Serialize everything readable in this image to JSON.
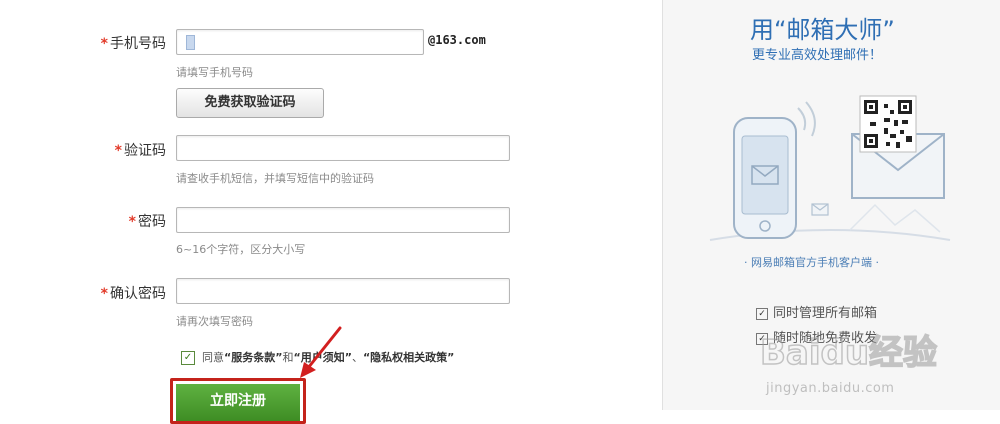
{
  "form": {
    "phone": {
      "label": "手机号码",
      "required_mark": "*",
      "value": "",
      "suffix": "@163.com",
      "hint": "请填写手机号码"
    },
    "get_code_button": "免费获取验证码",
    "code": {
      "label": "验证码",
      "required_mark": "*",
      "value": "",
      "hint": "请查收手机短信，并填写短信中的验证码"
    },
    "password": {
      "label": "密码",
      "required_mark": "*",
      "value": "",
      "hint": "6~16个字符，区分大小写"
    },
    "confirm_password": {
      "label": "确认密码",
      "required_mark": "*",
      "value": "",
      "hint": "请再次填写密码"
    },
    "agree": {
      "checked": true,
      "prefix": "同意",
      "terms": "“服务条款”",
      "and": "和",
      "notice": "“用户须知”",
      "sep": "、",
      "privacy": "“隐私权相关政策”"
    },
    "submit_label": "立即注册"
  },
  "promo": {
    "title": "用“邮箱大师”",
    "subtitle": "更专业高效处理邮件！",
    "client_caption": "· 网易邮箱官方手机客户端 ·",
    "features": [
      "同时管理所有邮箱",
      "随时随地免费收发"
    ]
  },
  "watermark": {
    "brand": "Baidu经验",
    "url": "jingyan.baidu.com"
  },
  "colors": {
    "accent_blue": "#2f6fb4",
    "required_red": "#e23b2a",
    "submit_green": "#4a9e2e",
    "highlight_red": "#c4231b"
  }
}
